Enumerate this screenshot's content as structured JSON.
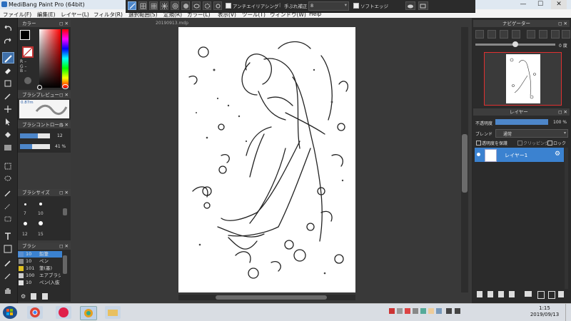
{
  "window": {
    "title": "MediBang Paint Pro (64bit)",
    "minimize": "—",
    "maximize": "☐",
    "close": "✕"
  },
  "menu": {
    "items": [
      "ファイル(F)",
      "編集(E)",
      "レイヤー(L)",
      "フィルタ(R)",
      "選択範囲(S)",
      "定規(R)",
      "カラー(L)",
      "表示(V)",
      "ツール(T)",
      "ウィンドウ(W)",
      "Help"
    ]
  },
  "toolbar": {
    "antialias_label": "アンチエイリアシング",
    "stabilizer_label": "手ぶれ補正",
    "stabilizer_value": "8",
    "soft_edge_label": "ソフトエッジ"
  },
  "document": {
    "tab_name": "20190913.mdp"
  },
  "color_panel": {
    "title": "カラー",
    "rgb_labels": [
      "R –",
      "G –",
      "B –"
    ]
  },
  "brush_preview": {
    "title": "ブラシプレビュー",
    "size_label": "0.87m"
  },
  "brush_control": {
    "title": "ブラシコントロール",
    "size_value": "12",
    "opacity_value": "41 %",
    "size_fraction": 0.6,
    "opacity_fraction": 0.41
  },
  "brush_size": {
    "title": "ブラシサイズ",
    "sizes": [
      "7",
      "10",
      "12",
      "15"
    ]
  },
  "brush_list": {
    "title": "ブラシ",
    "items": [
      {
        "size": "10",
        "name": "鉛筆",
        "swatch": "#5a8fd0",
        "selected": true
      },
      {
        "size": "10",
        "name": "ペン",
        "swatch": "#888888",
        "selected": false
      },
      {
        "size": "101",
        "name": "筆(墨)",
        "swatch": "#e0c020",
        "selected": false
      },
      {
        "size": "100",
        "name": "エアブラシ",
        "swatch": "#cccccc",
        "selected": false
      },
      {
        "size": "10",
        "name": "ペン(入抜",
        "swatch": "#e0e0e0",
        "selected": false
      }
    ]
  },
  "navigator": {
    "title": "ナビゲーター",
    "angle_label": "0 度"
  },
  "layer_panel": {
    "title": "レイヤー",
    "opacity_label": "不透明度",
    "opacity_value": "100 %",
    "opacity_fraction": 1.0,
    "blend_label": "ブレンド",
    "blend_value": "通常",
    "protect_alpha": "透明度を保護",
    "clipping": "クリッピング",
    "lock": "ロック",
    "layers": [
      {
        "name": "レイヤー1",
        "visible": true
      }
    ]
  },
  "taskbar": {
    "time": "1:15",
    "date": "2019/09/13"
  },
  "colors": {
    "accent": "#4d86c9",
    "foreground_color": "#000000",
    "background_color": "#ffffff"
  }
}
